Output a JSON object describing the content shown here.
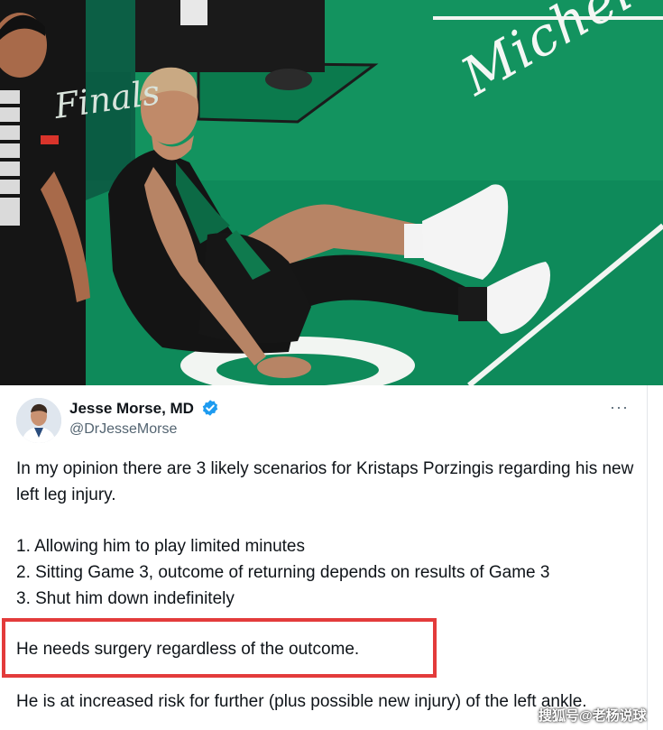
{
  "photo": {
    "finals_text": "Finals",
    "brand_text": "Michelob"
  },
  "tweet": {
    "author_name": "Jesse Morse, MD",
    "handle": "@DrJesseMorse",
    "more_label": "···",
    "verified": true,
    "paragraphs": {
      "intro": "In my opinion there are 3 likely scenarios for Kristaps Porzingis regarding his new left leg injury.",
      "item1": "1. Allowing him to play limited minutes",
      "item2": "2. Sitting Game 3, outcome of returning depends on results of Game 3",
      "item3": "3. Shut him down indefinitely",
      "surgery": "He needs surgery regardless of the outcome.",
      "risk": "He is at increased risk for further (plus possible new injury) of the left ankle."
    },
    "highlight_color": "#e33b3b"
  },
  "watermark": "搜狐号@老杨说球",
  "colors": {
    "court_green": "#0e8a5a",
    "verified_blue": "#1d9bf0",
    "text_primary": "#0f1419",
    "text_secondary": "#536471"
  }
}
